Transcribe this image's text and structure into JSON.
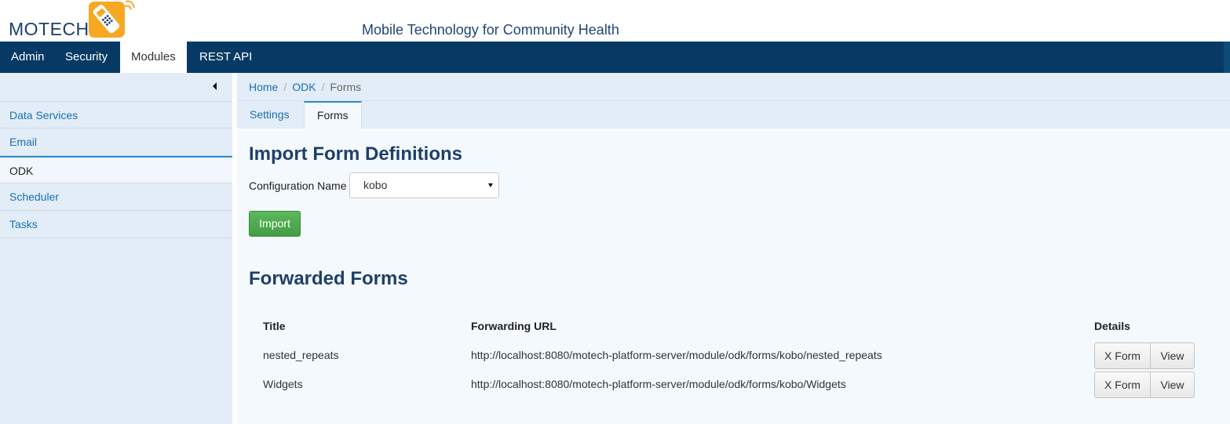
{
  "header": {
    "logo_text": "MOTECH",
    "tagline": "Mobile Technology for Community Health"
  },
  "nav": {
    "items": [
      "Admin",
      "Security",
      "Modules",
      "REST API"
    ],
    "active": "Modules"
  },
  "sidebar": {
    "items": [
      {
        "label": "Data Services"
      },
      {
        "label": "Email"
      },
      {
        "label": "ODK"
      },
      {
        "label": "Scheduler"
      },
      {
        "label": "Tasks"
      }
    ],
    "active": "ODK"
  },
  "breadcrumb": {
    "home": "Home",
    "module": "ODK",
    "current": "Forms",
    "separator": "/"
  },
  "tabs": [
    {
      "label": "Settings"
    },
    {
      "label": "Forms"
    }
  ],
  "import_section": {
    "heading": "Import Form Definitions",
    "config_label": "Configuration Name",
    "config_value": "kobo",
    "import_button": "Import"
  },
  "forwarded_section": {
    "heading": "Forwarded Forms",
    "columns": [
      "Title",
      "Forwarding URL",
      "Details"
    ],
    "rows": [
      {
        "title": "nested_repeats",
        "url": "http://localhost:8080/motech-platform-server/module/odk/forms/kobo/nested_repeats",
        "xform_button": "X Form",
        "view_button": "View"
      },
      {
        "title": "Widgets",
        "url": "http://localhost:8080/motech-platform-server/module/odk/forms/kobo/Widgets",
        "xform_button": "X Form",
        "view_button": "View"
      }
    ]
  },
  "colors": {
    "navbar": "#063a64",
    "sidebar_bg": "#e2edf7",
    "link": "#1c6fb0",
    "heading": "#1f3f6a",
    "import_button": "#5cb85c"
  }
}
